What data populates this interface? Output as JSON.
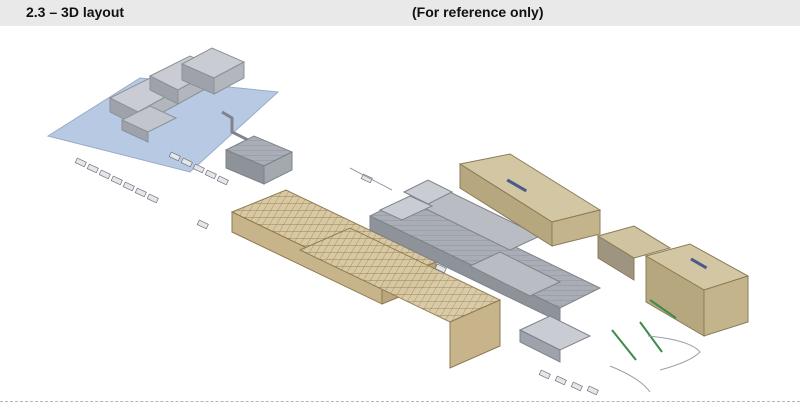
{
  "header": {
    "title": "2.3 – 3D layout",
    "note": "(For reference only)"
  },
  "illustration": {
    "subject": "3D isometric plant layout rendering",
    "colors": {
      "header_background": "#e9e9e9",
      "ground_zone": "#b7c9e3",
      "building_grey": "#b9bcc2",
      "steel_frame": "#c9b48a",
      "tan_block": "#c5b791",
      "text": "#111111"
    }
  }
}
